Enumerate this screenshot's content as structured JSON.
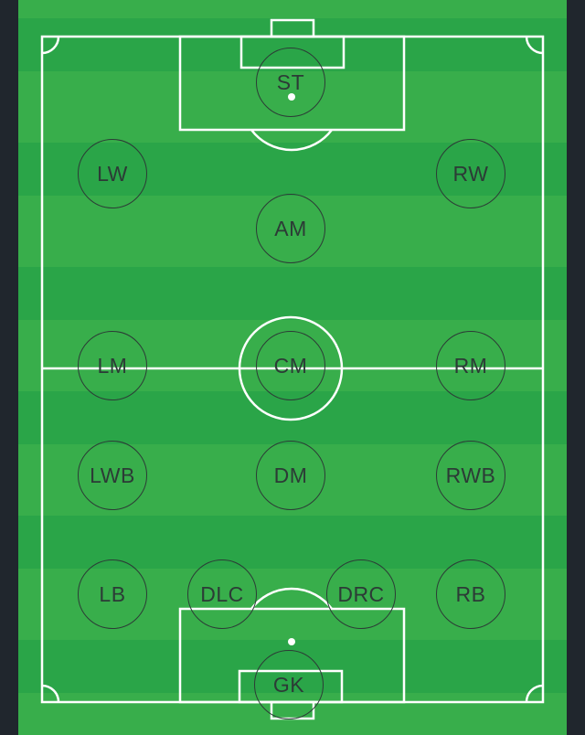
{
  "positions": [
    {
      "id": "st",
      "label": "ST"
    },
    {
      "id": "lw",
      "label": "LW"
    },
    {
      "id": "rw",
      "label": "RW"
    },
    {
      "id": "am",
      "label": "AM"
    },
    {
      "id": "lm",
      "label": "LM"
    },
    {
      "id": "cm",
      "label": "CM"
    },
    {
      "id": "rm",
      "label": "RM"
    },
    {
      "id": "lwb",
      "label": "LWB"
    },
    {
      "id": "dm",
      "label": "DM"
    },
    {
      "id": "rwb",
      "label": "RWB"
    },
    {
      "id": "lb",
      "label": "LB"
    },
    {
      "id": "dlc",
      "label": "DLC"
    },
    {
      "id": "drc",
      "label": "DRC"
    },
    {
      "id": "rb",
      "label": "RB"
    },
    {
      "id": "gk",
      "label": "GK"
    }
  ],
  "colors": {
    "pitch_light": "#38ae4b",
    "pitch_dark": "#2aa548",
    "lines": "#ffffff",
    "marker": "#2c3b36",
    "frame": "#20262d"
  }
}
